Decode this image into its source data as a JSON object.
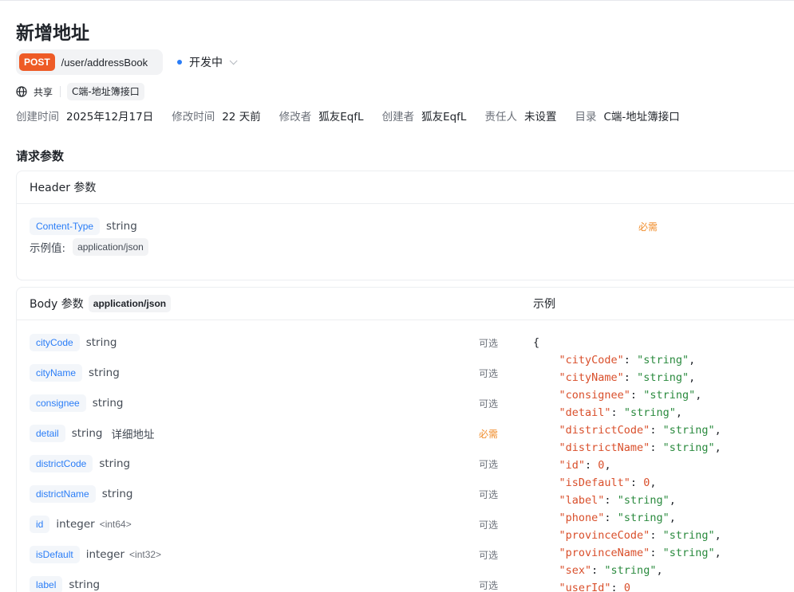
{
  "page": {
    "title": "新增地址",
    "method": "POST",
    "path": "/user/addressBook",
    "status": "开发中",
    "share_label": "共享",
    "folder_tag": "C端-地址簿接口"
  },
  "meta": [
    {
      "label": "创建时间",
      "value": "2025年12月17日"
    },
    {
      "label": "修改时间",
      "value": "22 天前"
    },
    {
      "label": "修改者",
      "value": "狐友EqfL"
    },
    {
      "label": "创建者",
      "value": "狐友EqfL"
    },
    {
      "label": "责任人",
      "value": "未设置"
    },
    {
      "label": "目录",
      "value": "C端-地址簿接口"
    }
  ],
  "request": {
    "section_title": "请求参数",
    "header": {
      "title": "Header 参数",
      "param": {
        "name": "Content-Type",
        "type": "string",
        "flag": "必需"
      },
      "example_label": "示例值:",
      "example_value": "application/json"
    },
    "body": {
      "title": "Body 参数",
      "content_type": "application/json",
      "params": [
        {
          "name": "cityCode",
          "type": "string",
          "format": "",
          "desc": "",
          "flag": "可选"
        },
        {
          "name": "cityName",
          "type": "string",
          "format": "",
          "desc": "",
          "flag": "可选"
        },
        {
          "name": "consignee",
          "type": "string",
          "format": "",
          "desc": "",
          "flag": "可选"
        },
        {
          "name": "detail",
          "type": "string",
          "format": "",
          "desc": "详细地址",
          "flag": "必需"
        },
        {
          "name": "districtCode",
          "type": "string",
          "format": "",
          "desc": "",
          "flag": "可选"
        },
        {
          "name": "districtName",
          "type": "string",
          "format": "",
          "desc": "",
          "flag": "可选"
        },
        {
          "name": "id",
          "type": "integer",
          "format": "<int64>",
          "desc": "",
          "flag": "可选"
        },
        {
          "name": "isDefault",
          "type": "integer",
          "format": "<int32>",
          "desc": "",
          "flag": "可选"
        },
        {
          "name": "label",
          "type": "string",
          "format": "",
          "desc": "",
          "flag": "可选"
        }
      ]
    },
    "example": {
      "title": "示例",
      "open_brace": "{",
      "fields": [
        {
          "key": "cityCode",
          "value": "string",
          "kind": "string"
        },
        {
          "key": "cityName",
          "value": "string",
          "kind": "string"
        },
        {
          "key": "consignee",
          "value": "string",
          "kind": "string"
        },
        {
          "key": "detail",
          "value": "string",
          "kind": "string"
        },
        {
          "key": "districtCode",
          "value": "string",
          "kind": "string"
        },
        {
          "key": "districtName",
          "value": "string",
          "kind": "string"
        },
        {
          "key": "id",
          "value": "0",
          "kind": "number"
        },
        {
          "key": "isDefault",
          "value": "0",
          "kind": "number"
        },
        {
          "key": "label",
          "value": "string",
          "kind": "string"
        },
        {
          "key": "phone",
          "value": "string",
          "kind": "string"
        },
        {
          "key": "provinceCode",
          "value": "string",
          "kind": "string"
        },
        {
          "key": "provinceName",
          "value": "string",
          "kind": "string"
        },
        {
          "key": "sex",
          "value": "string",
          "kind": "string"
        },
        {
          "key": "userId",
          "value": "0",
          "kind": "number"
        }
      ]
    }
  },
  "colors": {
    "post": "#ee5b26",
    "accent": "#2a7df7",
    "required": "#f08c2a",
    "json_key": "#d94f2b",
    "json_string": "#2a8a3e"
  },
  "icons": [
    "globe-icon",
    "status-dot-icon",
    "chevron-down-icon"
  ]
}
